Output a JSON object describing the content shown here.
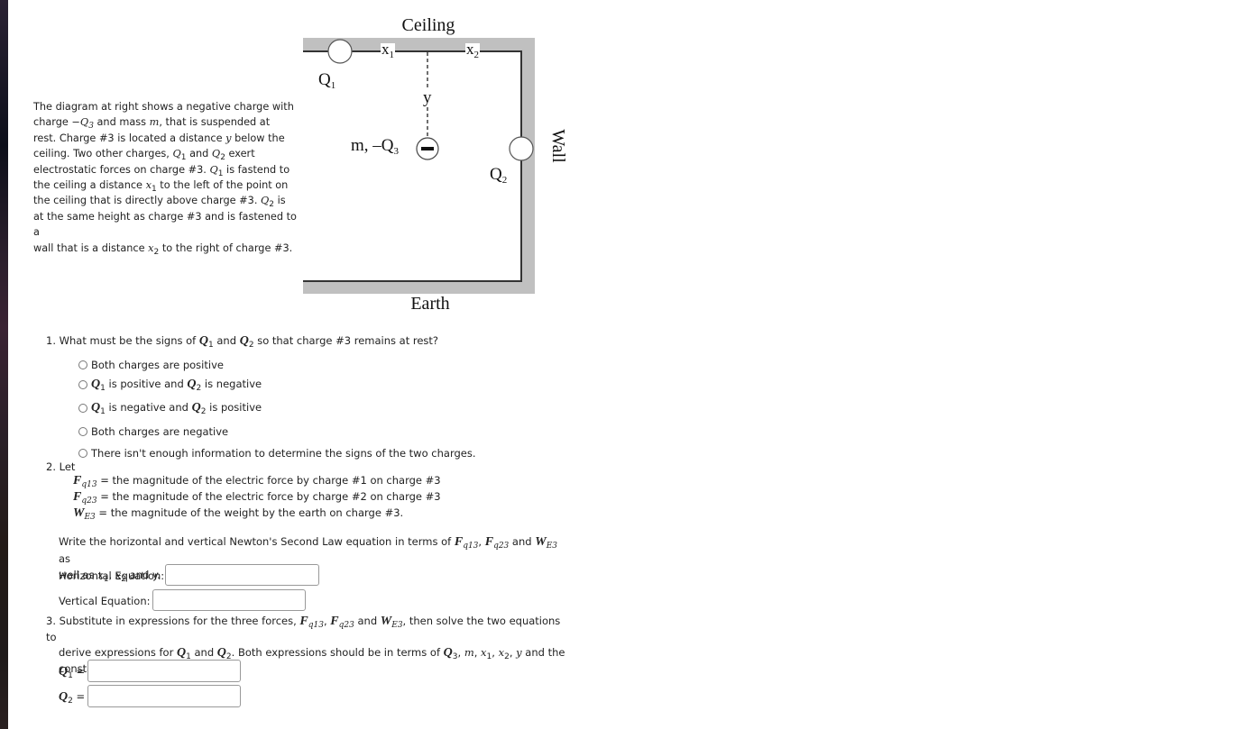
{
  "intro": {
    "line1": "The diagram at right shows a negative charge with",
    "line2_pre": "charge ",
    "line2_math": "−Q",
    "line2_sub": "3",
    "line2_mid": " and mass ",
    "line2_m": "m",
    "line2_post": ", that is suspended at",
    "line3_pre": "rest. Charge #3 is located a distance ",
    "line3_y": "y",
    "line3_post": " below the",
    "line4_pre": "ceiling. Two other charges, ",
    "line4_q1": "Q",
    "line4_q1sub": "1",
    "line4_and": " and ",
    "line4_q2": "Q",
    "line4_q2sub": "2",
    "line4_post": " exert",
    "line5_pre": "electrostatic forces on charge #3. ",
    "line5_q": "Q",
    "line5_qsub": "1",
    "line5_post": " is fastend to",
    "line6_pre": "the ceiling a distance ",
    "line6_x": "x",
    "line6_xsub": "1",
    "line6_post": " to the left of the point on",
    "line7_pre": "the ceiling that is directly above charge #3. ",
    "line7_q": "Q",
    "line7_qsub": "2",
    "line7_post": " is",
    "line8": "at the same height as charge #3 and is fastened to a",
    "line9_pre": "wall that is a distance ",
    "line9_x": "x",
    "line9_xsub": "2",
    "line9_post": " to the right of charge #3."
  },
  "diagram": {
    "ceiling_label": "Ceiling",
    "earth_label": "Earth",
    "wall_label": "Wall",
    "q1_label": "Q",
    "q1_sub": "1",
    "q2_label": "Q",
    "q2_sub": "2",
    "x1_label": "x",
    "x1_sub": "1",
    "x2_label": "x",
    "x2_sub": "2",
    "y_label": "y",
    "q3_label": "m, –Q",
    "q3_sub": "3",
    "q3_sign": "−",
    "wall_color": "#c0c0c0"
  },
  "question1": {
    "prompt_pre": "1. What must be the signs of ",
    "prompt_q1": "Q",
    "prompt_q1sub": "1",
    "prompt_and": " and ",
    "prompt_q2": "Q",
    "prompt_q2sub": "2",
    "prompt_post": " so that charge #3 remains at rest?",
    "options": [
      {
        "text": "Both charges are positive"
      },
      {
        "q": "Q",
        "qsub": "1",
        "mid": " is positive and ",
        "q2": "Q",
        "q2sub": "2",
        "post": " is negative"
      },
      {
        "q": "Q",
        "qsub": "1",
        "mid": " is negative and ",
        "q2": "Q",
        "q2sub": "2",
        "post": " is positive"
      },
      {
        "text": "Both charges are negative"
      },
      {
        "text": "There isn't enough information to determine the signs of the two charges."
      }
    ]
  },
  "question2": {
    "let": "2. Let",
    "defs": [
      {
        "sym": "F",
        "sub": "q13",
        "text": " = the magnitude of the electric force by charge #1 on charge #3"
      },
      {
        "sym": "F",
        "sub": "q23",
        "text": " = the magnitude of the electric force by charge #2 on charge #3"
      },
      {
        "sym": "W",
        "sub": "E3",
        "text": " = the magnitude of the weight by the earth on charge #3."
      }
    ],
    "write_pre": "Write the horizontal and vertical Newton's Second Law equation in terms of ",
    "write_f13": "F",
    "write_f13sub": "q13",
    "write_comma": ", ",
    "write_f23": "F",
    "write_f23sub": "q23",
    "write_and": " and ",
    "write_w": "W",
    "write_wsub": "E3",
    "write_as": " as",
    "write_line2_pre": "well as ",
    "write_x1": "x",
    "write_x1sub": "1",
    "write_c2": ", ",
    "write_x2": "x",
    "write_x2sub": "2",
    "write_line2_post": " and y.",
    "horizontal_label": "Horizontal Equation:",
    "horizontal_value": "",
    "vertical_label": "Vertical Equation:",
    "vertical_value": ""
  },
  "question3": {
    "l1_pre": "3. Substitute in expressions for the three forces, ",
    "l1_f13": "F",
    "l1_f13sub": "q13",
    "l1_c": ", ",
    "l1_f23": "F",
    "l1_f23sub": "q23",
    "l1_and": " and ",
    "l1_w": "W",
    "l1_wsub": "E3",
    "l1_post": ", then solve the two equations to",
    "l2_pre": "derive expressions for ",
    "l2_q1": "Q",
    "l2_q1sub": "1",
    "l2_and": " and ",
    "l2_q2": "Q",
    "l2_q2sub": "2",
    "l2_mid": ". Both expressions should be in terms of ",
    "l2_q3": "Q",
    "l2_q3sub": "3",
    "l2_c1": ", ",
    "l2_m": "m",
    "l2_c2": ", ",
    "l2_x1": "x",
    "l2_x1sub": "1",
    "l2_c3": ", ",
    "l2_x2": "x",
    "l2_x2sub": "2",
    "l2_c4": ", ",
    "l2_y": "y",
    "l2_post": " and the",
    "l3": "constants k and g.",
    "q1_label": "Q",
    "q1_sub": "1",
    "q1_eq": " =",
    "q1_value": "",
    "q2_label": "Q",
    "q2_sub": "2",
    "q2_eq": " =",
    "q2_value": ""
  }
}
